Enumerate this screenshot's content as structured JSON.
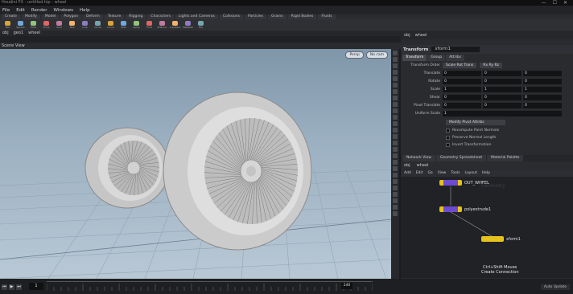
{
  "colors": {
    "accent": "#f2b40c",
    "viewport_sky": "#9bb0c1",
    "node_yellow": "#e6c21c",
    "node_purple": "#6d4bd0"
  },
  "titlebar": {
    "text": "Houdini FX - untitled.hip - wheel"
  },
  "window_controls": "— ☐ ✕",
  "menu": [
    "File",
    "Edit",
    "Render",
    "Windows",
    "Help"
  ],
  "shelf_tabs": [
    "Create",
    "Modify",
    "Model",
    "Polygon",
    "Deform",
    "Texture",
    "Rigging",
    "Characters",
    "Lights and Cameras",
    "Collisions",
    "Particles",
    "Grains",
    "Rigid Bodies",
    "Fluids"
  ],
  "shelf_tools": [
    "Box",
    "Sphere",
    "Tube",
    "Torus",
    "Grid",
    "Null",
    "Line",
    "Circle",
    "Curve",
    "Path",
    "Spray",
    "Font",
    "Platonic",
    "L-System",
    "Metaball",
    "File"
  ],
  "left_path": [
    "obj",
    "geo1",
    "wheel"
  ],
  "scene_tab": "Scene View",
  "viewport_buttons": [
    "Persp",
    "No cam"
  ],
  "timeline": {
    "frame": "1",
    "end": "240"
  },
  "right_path": [
    "obj",
    "wheel"
  ],
  "parameters": {
    "node_type": "Transform",
    "node_name": "xform1",
    "tabs": [
      "Transform",
      "Group",
      "Attribs"
    ],
    "rows": [
      {
        "label": "Transform Order",
        "values": [
          "Scale Rot Trans",
          "Rx Ry Rz"
        ]
      },
      {
        "label": "Translate",
        "values": [
          "0",
          "0",
          "0"
        ]
      },
      {
        "label": "Rotate",
        "values": [
          "0",
          "0",
          "0"
        ]
      },
      {
        "label": "Scale",
        "values": [
          "1",
          "1",
          "1"
        ]
      },
      {
        "label": "Shear",
        "values": [
          "0",
          "0",
          "0"
        ]
      },
      {
        "label": "Pivot Translate",
        "values": [
          "0",
          "0",
          "0"
        ]
      },
      {
        "label": "Uniform Scale",
        "values": [
          "1"
        ]
      }
    ],
    "menu_row": "Modify Pivot Attribs",
    "checkboxes": [
      "Recompute Point Normals",
      "Preserve Normal Length",
      "Invert Transformation"
    ]
  },
  "network": {
    "tabs": [
      "Network View",
      "Geometry Spreadsheet",
      "Material Palette"
    ],
    "path": [
      "obj",
      "wheel"
    ],
    "tools": [
      "Add",
      "Edit",
      "Go",
      "View",
      "Tools",
      "Layout",
      "Help"
    ],
    "watermark": "Geometry",
    "nodes": [
      {
        "name": "OUT_WHEEL",
        "color": "#6d4bd0"
      },
      {
        "name": "polyextrude1",
        "color": "#6d4bd0"
      },
      {
        "name": "xform1",
        "color": "#e6c21c"
      }
    ],
    "status_line1": "Ctrl+Shift Mouse",
    "status_line2": "Create Connection"
  },
  "status_text": "Auto Update"
}
